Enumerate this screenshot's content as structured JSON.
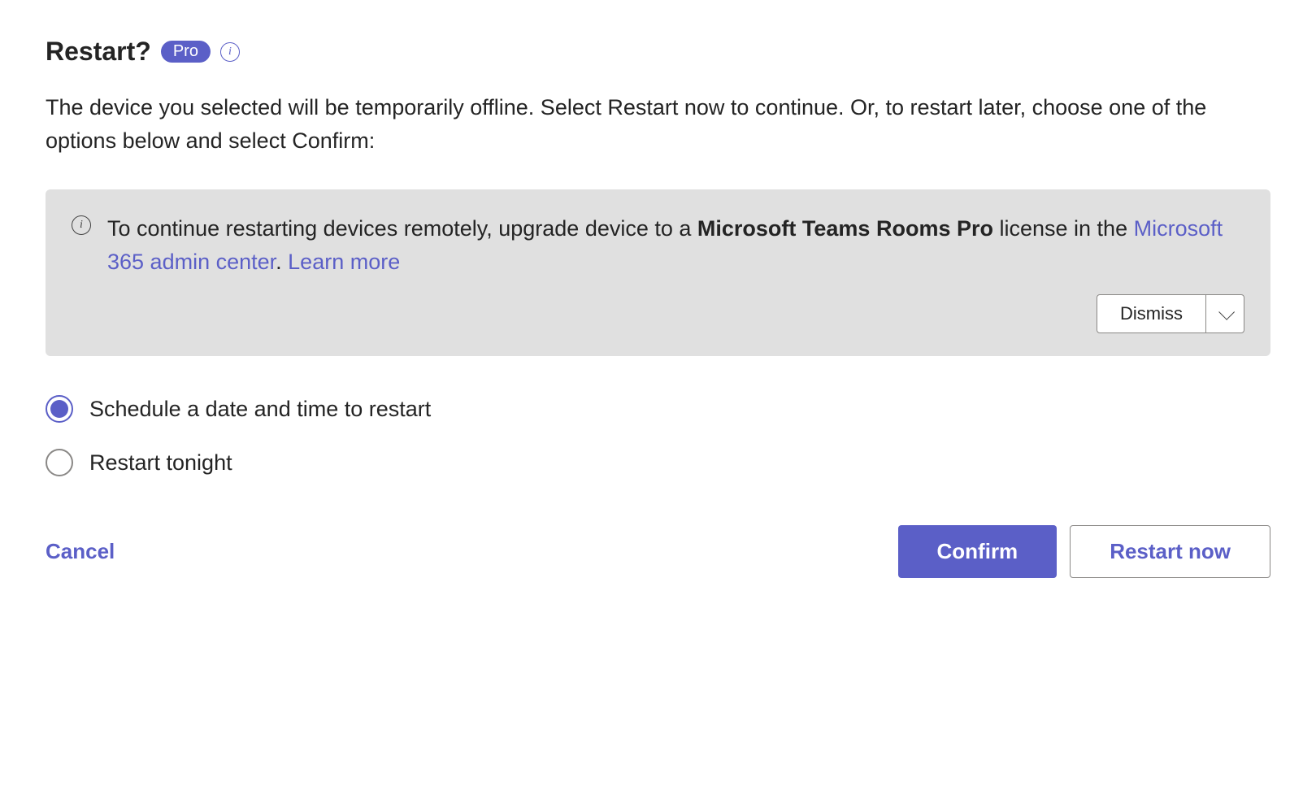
{
  "header": {
    "title": "Restart?",
    "badge": "Pro"
  },
  "description": "The device you selected will be temporarily offline. Select Restart now to continue. Or, to restart later, choose one of the options below and select Confirm:",
  "banner": {
    "text_part1": "To continue restarting devices remotely, upgrade device to a ",
    "text_bold1": "Microsoft Teams Rooms Pro",
    "text_part2": " license in the ",
    "link1": "Microsoft 365 admin center",
    "text_part3": ". ",
    "link2": "Learn more",
    "dismiss": "Dismiss"
  },
  "options": {
    "schedule": "Schedule a date and time to restart",
    "tonight": "Restart tonight"
  },
  "footer": {
    "cancel": "Cancel",
    "confirm": "Confirm",
    "restart_now": "Restart now"
  }
}
